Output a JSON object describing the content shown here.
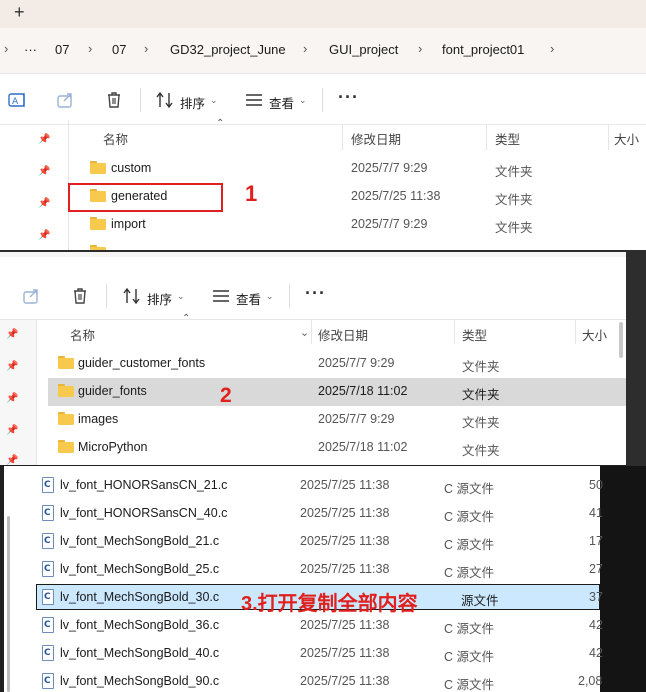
{
  "panel1": {
    "tab_add": "+",
    "breadcrumb": [
      "···",
      "07",
      "07",
      "GD32_project_June",
      "GUI_project",
      "font_project01"
    ],
    "toolbar": {
      "sort_label": "排序",
      "view_label": "查看",
      "more_label": "···"
    },
    "columns": {
      "name": "名称",
      "date": "修改日期",
      "type": "类型",
      "size": "大小"
    },
    "rows": [
      {
        "name": "custom",
        "date": "2025/7/7 9:29",
        "type": "文件夹"
      },
      {
        "name": "generated",
        "date": "2025/7/25 11:38",
        "type": "文件夹"
      },
      {
        "name": "import",
        "date": "2025/7/7 9:29",
        "type": "文件夹"
      }
    ],
    "annotation": "1"
  },
  "panel2": {
    "toolbar": {
      "sort_label": "排序",
      "view_label": "查看",
      "more_label": "···"
    },
    "columns": {
      "name": "名称",
      "date": "修改日期",
      "type": "类型",
      "size": "大小"
    },
    "rows": [
      {
        "name": "guider_customer_fonts",
        "date": "2025/7/7 9:29",
        "type": "文件夹"
      },
      {
        "name": "guider_fonts",
        "date": "2025/7/18 11:02",
        "type": "文件夹"
      },
      {
        "name": "images",
        "date": "2025/7/7 9:29",
        "type": "文件夹"
      },
      {
        "name": "MicroPython",
        "date": "2025/7/18 11:02",
        "type": "文件夹"
      }
    ],
    "annotation": "2"
  },
  "panel3": {
    "rows": [
      {
        "name": "lv_font_HONORSansCN_21.c",
        "date": "2025/7/25 11:38",
        "type": "C 源文件",
        "size": "50"
      },
      {
        "name": "lv_font_HONORSansCN_40.c",
        "date": "2025/7/25 11:38",
        "type": "C 源文件",
        "size": "41"
      },
      {
        "name": "lv_font_MechSongBold_21.c",
        "date": "2025/7/25 11:38",
        "type": "C 源文件",
        "size": "17"
      },
      {
        "name": "lv_font_MechSongBold_25.c",
        "date": "2025/7/25 11:38",
        "type": "C 源文件",
        "size": "27"
      },
      {
        "name": "lv_font_MechSongBold_30.c",
        "date": "2025/7/25 11:38",
        "type": "源文件",
        "size": "37"
      },
      {
        "name": "lv_font_MechSongBold_36.c",
        "date": "2025/7/25 11:38",
        "type": "C 源文件",
        "size": "42"
      },
      {
        "name": "lv_font_MechSongBold_40.c",
        "date": "2025/7/25 11:38",
        "type": "C 源文件",
        "size": "42"
      },
      {
        "name": "lv_font_MechSongBold_90.c",
        "date": "2025/7/25 11:38",
        "type": "C 源文件",
        "size": "2,08"
      }
    ],
    "file_icon_letter": "C",
    "annotation": "3.打开复制全部内容"
  },
  "colors": {
    "annotation_red": "#e0201c",
    "folder_yellow": "#f7c94c",
    "selected_row": "#cce8ff",
    "hover_row": "#d9d9d9"
  }
}
